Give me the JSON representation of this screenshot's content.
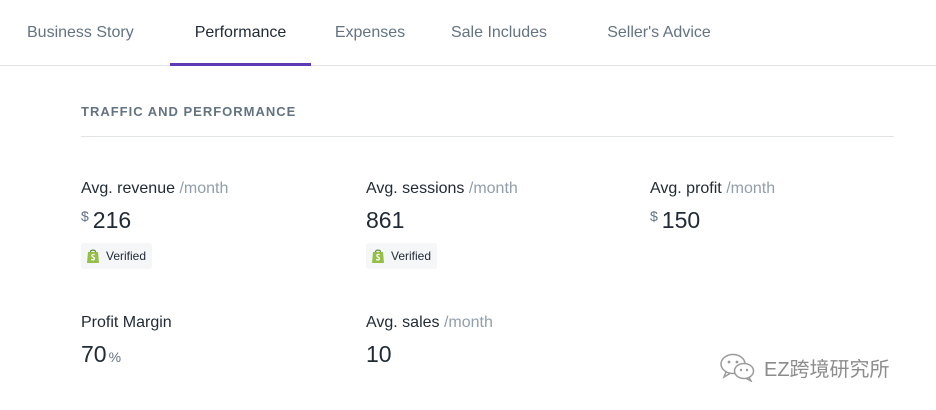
{
  "tabs": [
    {
      "label": "Business Story",
      "active": false
    },
    {
      "label": "Performance",
      "active": true
    },
    {
      "label": "Expenses",
      "active": false
    },
    {
      "label": "Sale Includes",
      "active": false
    },
    {
      "label": "Seller's Advice",
      "active": false
    }
  ],
  "colors": {
    "accent": "#5c3bb5",
    "shopify_green": "#95bf47"
  },
  "section": {
    "title": "TRAFFIC AND PERFORMANCE"
  },
  "metrics": {
    "revenue": {
      "label": "Avg. revenue",
      "unit": "/month",
      "currency": "$",
      "value": "216",
      "badge": "Verified"
    },
    "sessions": {
      "label": "Avg. sessions",
      "unit": "/month",
      "value": "861",
      "badge": "Verified"
    },
    "profit": {
      "label": "Avg. profit",
      "unit": "/month",
      "currency": "$",
      "value": "150"
    },
    "margin": {
      "label": "Profit Margin",
      "value": "70",
      "suffix": "%"
    },
    "sales": {
      "label": "Avg. sales",
      "unit": "/month",
      "value": "10"
    }
  },
  "icons": {
    "badge_icon": "shopify-bag-icon",
    "watermark_icon": "wechat-icon"
  },
  "watermark": {
    "text": "EZ跨境研究所"
  }
}
